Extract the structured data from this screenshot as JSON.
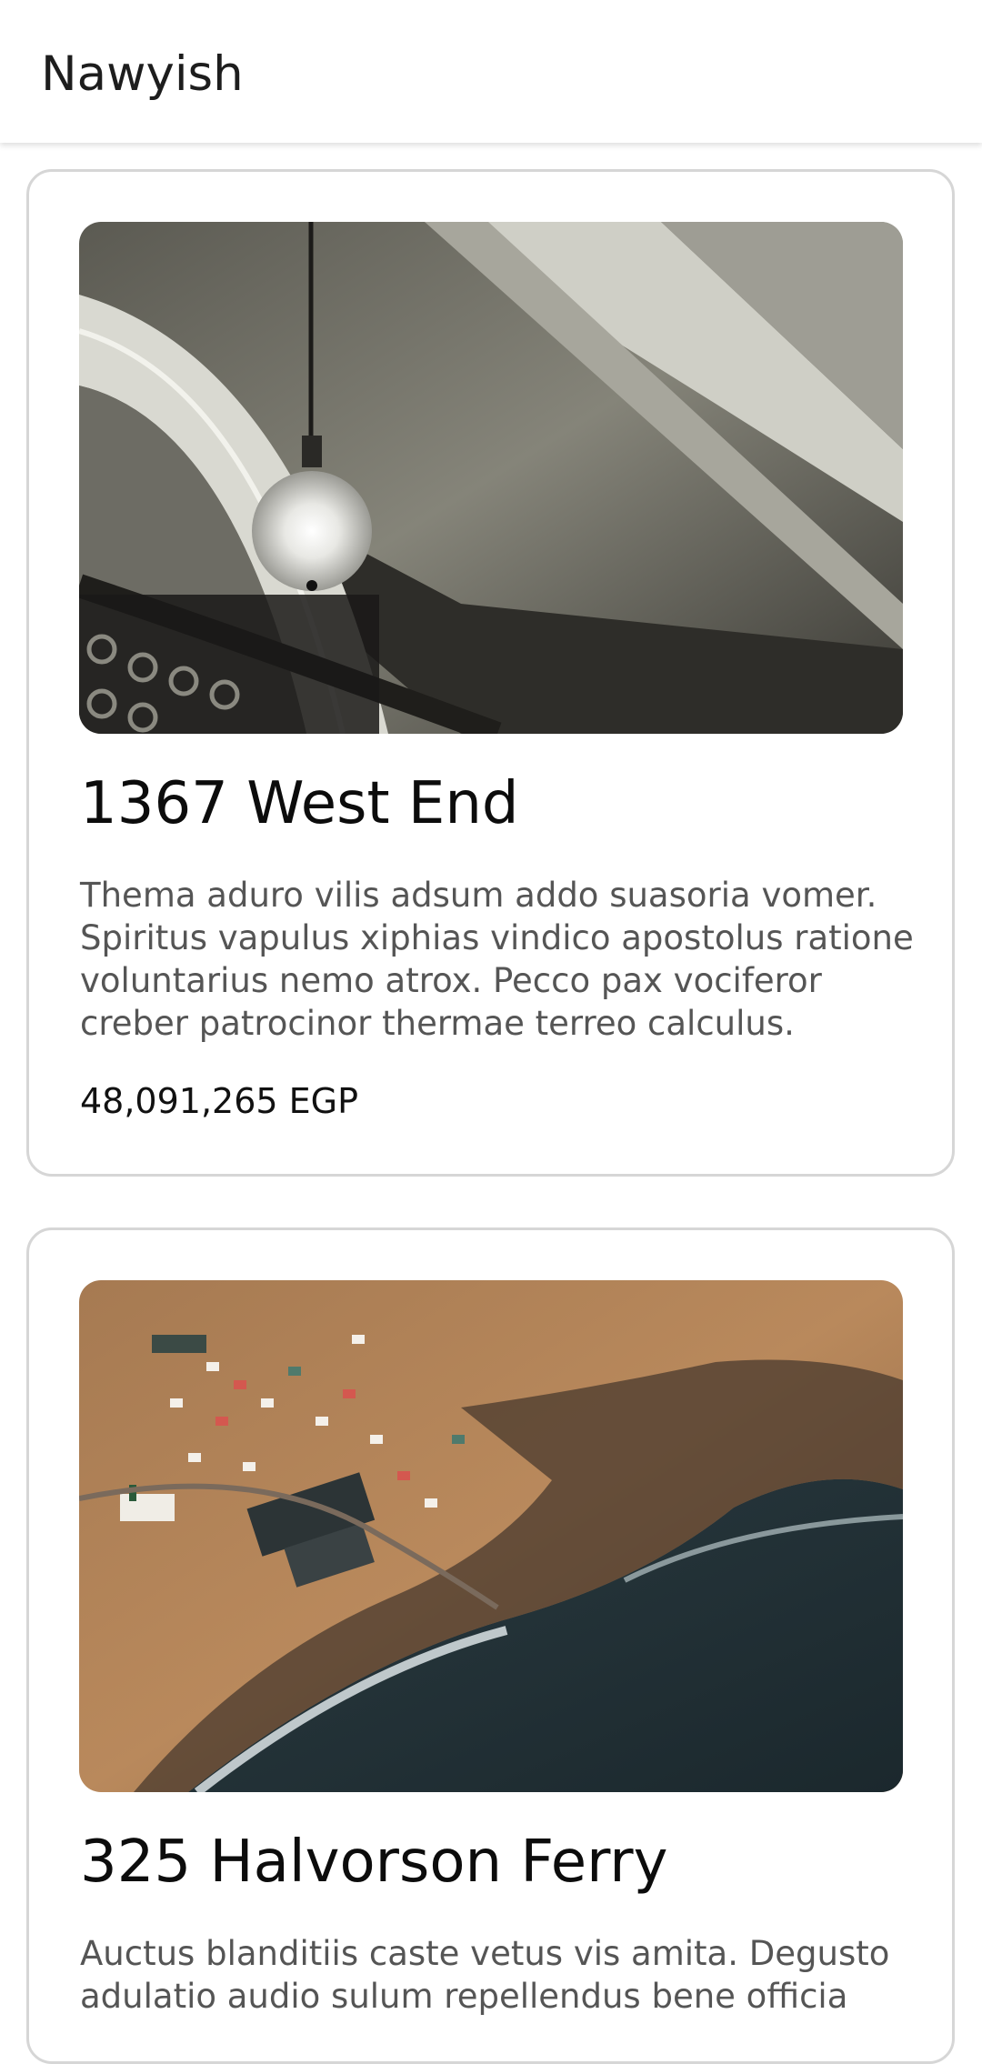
{
  "app": {
    "title": "Nawyish"
  },
  "listings": [
    {
      "title": "1367 West End",
      "description": "Thema aduro vilis adsum addo suasoria vomer. Spiritus vapulus xiphias vindico apostolus ratione voluntarius nemo atrox. Pecco pax vociferor creber patrocinor thermae terreo calculus.",
      "price": "48,091,265 EGP",
      "image_subject": "interior-pendant-lamp-photo"
    },
    {
      "title": "325 Halvorson Ferry",
      "description": "Auctus blanditiis caste vetus vis amita. Degusto adulatio audio sulum repellendus bene officia",
      "image_subject": "aerial-coastal-village-photo"
    }
  ]
}
